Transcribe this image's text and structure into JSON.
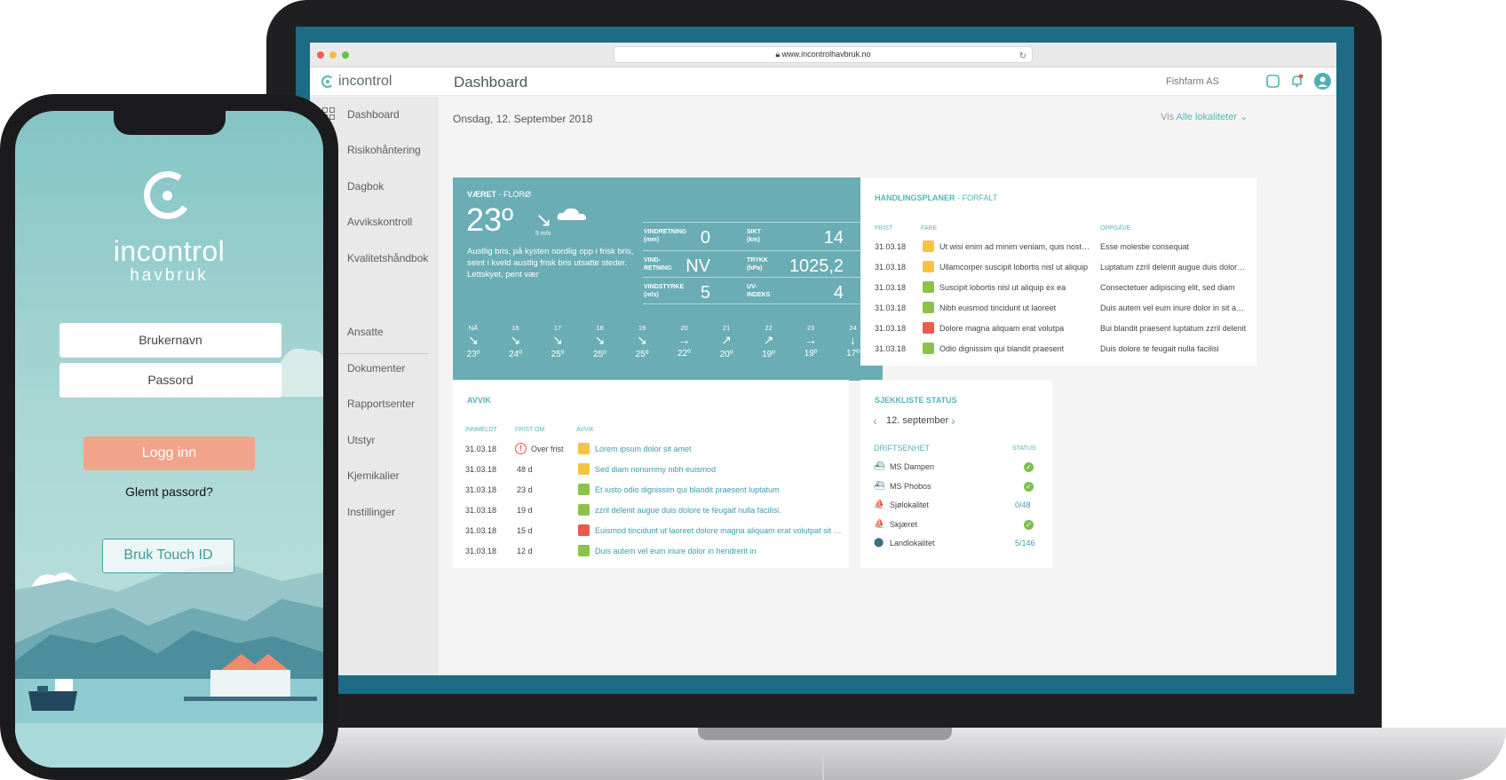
{
  "browser": {
    "url": "www.incontrolhavbruk.no"
  },
  "app": {
    "brand": "incontrol",
    "page_title": "Dashboard",
    "org": "Fishfarm AS"
  },
  "sidebar": {
    "items": [
      {
        "label": "Dashboard",
        "icon": "grid-icon"
      },
      {
        "label": "Risikohåntering"
      },
      {
        "label": "Dagbok"
      },
      {
        "label": "Avvikskontroll"
      },
      {
        "label": "Kvalitetshåndbok"
      },
      {
        "label": "Ansatte"
      },
      {
        "label": "Dokumenter"
      },
      {
        "label": "Rapportsenter"
      },
      {
        "label": "Utstyr"
      },
      {
        "label": "Kjemikalier"
      },
      {
        "label": "Instillinger"
      }
    ]
  },
  "main": {
    "date": "Onsdag, 12. September 2018",
    "vis_prefix": "Vis",
    "vis_link": "Alle lokaliteter"
  },
  "weather": {
    "title": "VÆRET",
    "location": "- FLORØ",
    "temp": "23º",
    "arrow": "↘",
    "wind": "5 m/s",
    "description": "Austlig bris, på kysten nordlig opp i frisk bris, seint i kveld austlig frisk bris utsatte steder. Lettskyet, pent vær",
    "stats": [
      {
        "label_l1": "VINDRETNING",
        "label_l2": "(mm)",
        "value": "0"
      },
      {
        "label_l1": "SIKT",
        "label_l2": "(km)",
        "value": "14"
      },
      {
        "label_l1": "VIND-",
        "label_l2": "RETNING",
        "value": "NV"
      },
      {
        "label_l1": "TRYKK",
        "label_l2": "(hPa)",
        "value": "1025,2"
      },
      {
        "label_l1": "VINDSTYRKE",
        "label_l2": "(m/s)",
        "value": "5"
      },
      {
        "label_l1": "UV-",
        "label_l2": "INDEKS",
        "value": "4"
      }
    ],
    "forecast": [
      {
        "hour": "NÅ",
        "arrow": "↘",
        "temp": "23º"
      },
      {
        "hour": "16",
        "arrow": "↘",
        "temp": "24º"
      },
      {
        "hour": "17",
        "arrow": "↘",
        "temp": "25º"
      },
      {
        "hour": "18",
        "arrow": "↘",
        "temp": "25º"
      },
      {
        "hour": "19",
        "arrow": "↘",
        "temp": "25º"
      },
      {
        "hour": "20",
        "arrow": "→",
        "temp": "22º"
      },
      {
        "hour": "21",
        "arrow": "↗",
        "temp": "20º"
      },
      {
        "hour": "22",
        "arrow": "↗",
        "temp": "19º"
      },
      {
        "hour": "23",
        "arrow": "→",
        "temp": "19º"
      },
      {
        "hour": "24",
        "arrow": "↓",
        "temp": "17º"
      }
    ]
  },
  "plans": {
    "title": "HANDLINGSPLANER",
    "subtitle": "- FORFALT",
    "headers": [
      "FRIST",
      "FARE",
      "OPPGÅVE"
    ],
    "rows": [
      {
        "date": "31.03.18",
        "color": "#f5c542",
        "fare": "Ut wisi enim ad minim veniam, quis nostrud",
        "task": "Esse molestie consequat"
      },
      {
        "date": "31.03.18",
        "color": "#f5c542",
        "fare": "Ullamcorper suscipit lobortis nisl ut aliquip",
        "task": "Luptatum zzril delenit augue duis dolore te"
      },
      {
        "date": "31.03.18",
        "color": "#8bc34a",
        "fare": "Suscipit lobortis nisl ut aliquip ex ea",
        "task": "Consectetuer adipiscing elit, sed diam"
      },
      {
        "date": "31.03.18",
        "color": "#8bc34a",
        "fare": "Nibh euismod tincidunt ut laoreet",
        "task": "Duis autem vel eum iriure dolor in sit amet"
      },
      {
        "date": "31.03.18",
        "color": "#ea5b4b",
        "fare": "Dolore magna aliquam erat volutpa",
        "task": "Bui blandit praesent luptatum zzril delenit"
      },
      {
        "date": "31.03.18",
        "color": "#8bc34a",
        "fare": "Odio dignissim qui blandit praesent",
        "task": "Duis dolore te feugait nulla facilisi"
      }
    ]
  },
  "avvik": {
    "title": "AVVIK",
    "headers": [
      "INNMELDT",
      "FRIST OM",
      "AVVIK"
    ],
    "rows": [
      {
        "date": "31.03.18",
        "due": "Over frist",
        "overdue": true,
        "color": "#f5c542",
        "text": "Lorem ipsum dolor sit amet"
      },
      {
        "date": "31.03.18",
        "due": "48 d",
        "color": "#f5c542",
        "text": "Sed diam nonummy nibh euismod"
      },
      {
        "date": "31.03.18",
        "due": "23 d",
        "color": "#8bc34a",
        "text": "Et iusto odio dignissim qui blandit praesent luptatum"
      },
      {
        "date": "31.03.18",
        "due": "19 d",
        "color": "#8bc34a",
        "text": "zzril delenit augue duis dolore te feugait nulla facilisi."
      },
      {
        "date": "31.03.18",
        "due": "15 d",
        "color": "#ea5b4b",
        "text": "Euismod tincidunt ut laoreet dolore magna aliquam erat volutpat sit amet"
      },
      {
        "date": "31.03.18",
        "due": "12 d",
        "color": "#8bc34a",
        "text": "Duis autem vel eum iriure dolor in hendrerit in"
      }
    ]
  },
  "checklist": {
    "title": "SJEKKLISTE STATUS",
    "date": "12. september",
    "col_unit": "DRIFTSENHET",
    "col_status": "STATUS",
    "rows": [
      {
        "icon": "boat-icon",
        "name": "MS Dampen",
        "status": "",
        "ok": true
      },
      {
        "icon": "boat-icon",
        "name": "MS Phobos",
        "status": "",
        "ok": true
      },
      {
        "icon": "sea-site-icon",
        "name": "Sjølokalitet",
        "status": "0/48",
        "ok": false
      },
      {
        "icon": "sea-site-icon",
        "name": "Skjæret",
        "status": "",
        "ok": true
      },
      {
        "icon": "land-pin-icon",
        "name": "Landlokalitet",
        "status": "5/146",
        "ok": false
      }
    ]
  },
  "phone": {
    "logo_name": "incontrol",
    "logo_sub": "havbruk",
    "username_placeholder": "Brukernavn",
    "password_placeholder": "Passord",
    "login_label": "Logg inn",
    "forgot_label": "Glemt passord?",
    "touch_label": "Bruk Touch ID"
  }
}
